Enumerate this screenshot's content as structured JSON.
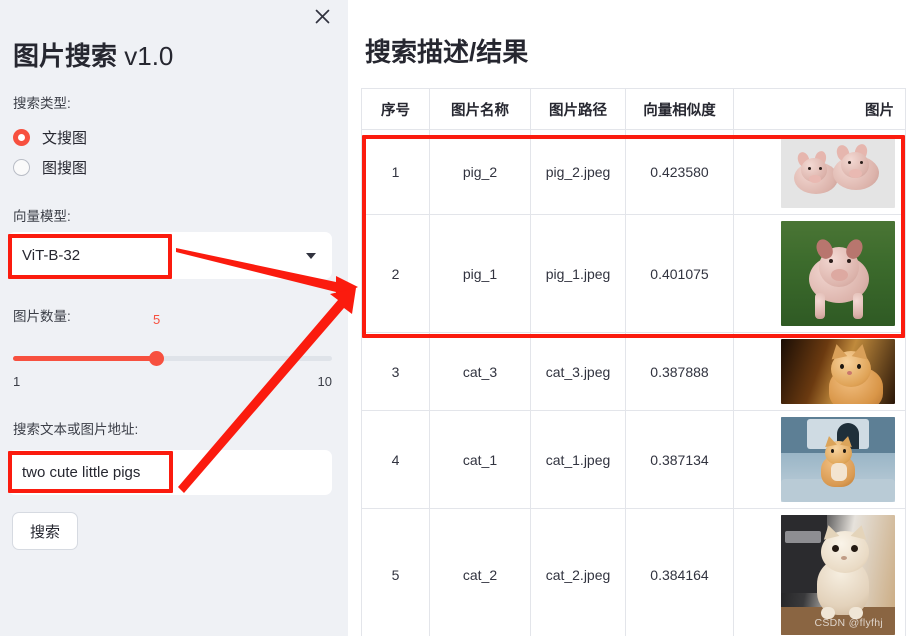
{
  "sidebar": {
    "close_icon": "close-icon",
    "title_main": "图片搜索",
    "title_version": " v1.0",
    "search_type_label": "搜索类型:",
    "radio_options": [
      {
        "label": "文搜图",
        "selected": true
      },
      {
        "label": "图搜图",
        "selected": false
      }
    ],
    "model_label": "向量模型:",
    "model_value": "ViT-B-32",
    "model_dropdown_icon": "chevron-down-icon",
    "count_label": "图片数量:",
    "slider": {
      "value": "5",
      "min": "1",
      "max": "10"
    },
    "query_label": "搜索文本或图片地址:",
    "query_value": "two cute little pigs",
    "query_placeholder": "",
    "search_button": "搜索"
  },
  "main": {
    "title": "搜索描述/结果",
    "table": {
      "headers": [
        "序号",
        "图片名称",
        "图片路径",
        "向量相似度",
        "图片"
      ],
      "rows": [
        {
          "index": "1",
          "name": "pig_2",
          "path": "pig_2.jpeg",
          "similarity": "0.423580",
          "thumb": "pig-two-piglets"
        },
        {
          "index": "2",
          "name": "pig_1",
          "path": "pig_1.jpeg",
          "similarity": "0.401075",
          "thumb": "pig-in-grass"
        },
        {
          "index": "3",
          "name": "cat_3",
          "path": "cat_3.jpeg",
          "similarity": "0.387888",
          "thumb": "orange-kitten-dark"
        },
        {
          "index": "4",
          "name": "cat_1",
          "path": "cat_1.jpeg",
          "similarity": "0.387134",
          "thumb": "kitten-on-tower"
        },
        {
          "index": "5",
          "name": "cat_2",
          "path": "cat_2.jpeg",
          "similarity": "0.384164",
          "thumb": "cream-cat-standing"
        }
      ]
    },
    "watermark": "CSDN @flyfhj"
  },
  "colors": {
    "accent_red": "#f7503f",
    "annotation_red": "#fb1b0e",
    "sidebar_bg": "#eff1f5",
    "text": "#262730",
    "table_border": "#e3e5ea"
  }
}
